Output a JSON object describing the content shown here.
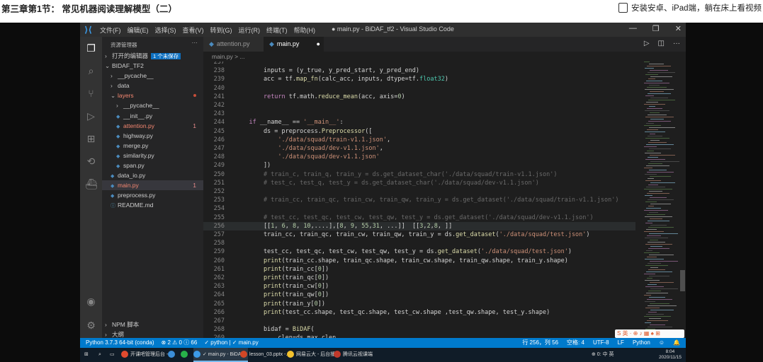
{
  "page": {
    "title": "第三章第1节： 常见机器阅读理解模型（二）",
    "header_right_text": "安装安卓、iPad端，躺在床上看视频"
  },
  "vscode": {
    "menu": [
      "文件(F)",
      "编辑(E)",
      "选择(S)",
      "查看(V)",
      "转到(G)",
      "运行(R)",
      "终端(T)",
      "帮助(H)"
    ],
    "window_title": "● main.py - BiDAF_tf2 - Visual Studio Code",
    "explorer_title": "资源管理器",
    "open_editors": "打开的编辑器",
    "unsaved_badge": "1 个未保存",
    "tree": [
      {
        "label": "BIDAF_TF2",
        "chev": "∨",
        "indent": 1,
        "folder": true
      },
      {
        "label": "__pycache__",
        "chev": ">",
        "indent": 2,
        "folder": true
      },
      {
        "label": "data",
        "chev": ">",
        "indent": 2,
        "folder": true
      },
      {
        "label": "layers",
        "chev": "∨",
        "indent": 2,
        "folder": true,
        "red": true,
        "dot": true
      },
      {
        "label": "__pycache__",
        "chev": ">",
        "indent": 3,
        "folder": true
      },
      {
        "label": "__init__.py",
        "indent": 3
      },
      {
        "label": "attention.py",
        "indent": 3,
        "red": true,
        "count": "1"
      },
      {
        "label": "highway.py",
        "indent": 3
      },
      {
        "label": "merge.py",
        "indent": 3
      },
      {
        "label": "similarity.py",
        "indent": 3
      },
      {
        "label": "span.py",
        "indent": 3
      },
      {
        "label": "data_io.py",
        "indent": 2
      },
      {
        "label": "main.py",
        "indent": 2,
        "red": true,
        "count": "1",
        "active": true
      },
      {
        "label": "preprocess.py",
        "indent": 2
      },
      {
        "label": "README.md",
        "indent": 2,
        "md": true
      }
    ],
    "npm_scripts": "NPM 脚本",
    "outline": "大纲",
    "tabs": {
      "attention": "attention.py",
      "main": "main.py"
    },
    "breadcrumb": "main.py > ...",
    "code_lines": [
      {
        "n": "237",
        "t": ""
      },
      {
        "n": "238",
        "t": "        inputs = (y_true, y_pred_start, y_pred_end)"
      },
      {
        "n": "239",
        "t": "        acc = tf.map_fn(calc_acc, inputs, dtype=tf.float32)"
      },
      {
        "n": "240",
        "t": ""
      },
      {
        "n": "241",
        "t": "        return tf.math.reduce_mean(acc, axis=0)"
      },
      {
        "n": "242",
        "t": ""
      },
      {
        "n": "243",
        "t": ""
      },
      {
        "n": "244",
        "t": "    if __name__ == '__main__':"
      },
      {
        "n": "245",
        "t": "        ds = preprocess.Preprocessor(["
      },
      {
        "n": "246",
        "t": "            './data/squad/train-v1.1.json',"
      },
      {
        "n": "247",
        "t": "            './data/squad/dev-v1.1.json',"
      },
      {
        "n": "248",
        "t": "            './data/squad/dev-v1.1.json'"
      },
      {
        "n": "249",
        "t": "        ])"
      },
      {
        "n": "250",
        "t": "        # train_c, train_q, train_y = ds.get_dataset_char('./data/squad/train-v1.1.json')"
      },
      {
        "n": "251",
        "t": "        # test_c, test_q, test_y = ds.get_dataset_char('./data/squad/dev-v1.1.json')"
      },
      {
        "n": "252",
        "t": ""
      },
      {
        "n": "253",
        "t": "        # train_cc, train_qc, train_cw, train_qw, train_y = ds.get_dataset('./data/squad/train-v1.1.json')"
      },
      {
        "n": "254",
        "t": ""
      },
      {
        "n": "255",
        "t": "        # test_cc, test_qc, test_cw, test_qw, test_y = ds.get_dataset('./data/squad/dev-v1.1.json')"
      },
      {
        "n": "256",
        "t": "        [[1, 6, 8, 10,....],[8, 9, 55,31, ...]]  [[3,2,8, ]]"
      },
      {
        "n": "257",
        "t": "        train_cc, train_qc, train_cw, train_qw, train_y = ds.get_dataset('./data/squad/test.json')"
      },
      {
        "n": "258",
        "t": ""
      },
      {
        "n": "259",
        "t": "        test_cc, test_qc, test_cw, test_qw, test_y = ds.get_dataset('./data/squad/test.json')"
      },
      {
        "n": "260",
        "t": "        print(train_cc.shape, train_qc.shape, train_cw.shape, train_qw.shape, train_y.shape)"
      },
      {
        "n": "261",
        "t": "        print(train_cc[0])"
      },
      {
        "n": "262",
        "t": "        print(train_qc[0])"
      },
      {
        "n": "263",
        "t": "        print(train_cw[0])"
      },
      {
        "n": "264",
        "t": "        print(train_qw[0])"
      },
      {
        "n": "265",
        "t": "        print(train_y[0])"
      },
      {
        "n": "266",
        "t": "        print(test_cc.shape, test_qc.shape, test_cw.shape ,test_qw.shape, test_y.shape)"
      },
      {
        "n": "267",
        "t": ""
      },
      {
        "n": "268",
        "t": "        bidaf = BiDAF("
      },
      {
        "n": "269",
        "t": "            clen=ds.max_clen,"
      }
    ],
    "status": {
      "python": "Python 3.7.3 64-bit (conda)",
      "problems": "⊗ 2 ⚠ 0 ⓘ 66",
      "python_tag": "✓ python | ✓ main.py",
      "position": "行 256，列 56",
      "spaces": "空格: 4",
      "encoding": "UTF-8",
      "eol": "LF",
      "lang": "Python"
    },
    "ime": "S 英 · ⊕ ♪ ▦ ♠ ⊞",
    "taskbar": [
      {
        "label": "开课吧管理后台 -...",
        "color": "#e04a2f"
      },
      {
        "label": "",
        "color": "#3b8ed9"
      },
      {
        "label": "",
        "color": "#27b14a"
      },
      {
        "label": "✓ main.py - BiDA...",
        "color": "#3c9be8",
        "active": true
      },
      {
        "label": "lesson_03.pptx -...",
        "color": "#d24726"
      },
      {
        "label": "网易云大 - 后台播",
        "color": "#f2c12e"
      },
      {
        "label": "腾讯云视课端",
        "color": "#c0392b"
      }
    ],
    "clock_time": "8:04",
    "clock_date": "2020/11/15",
    "tray": "⊕ 0: 中 英"
  }
}
